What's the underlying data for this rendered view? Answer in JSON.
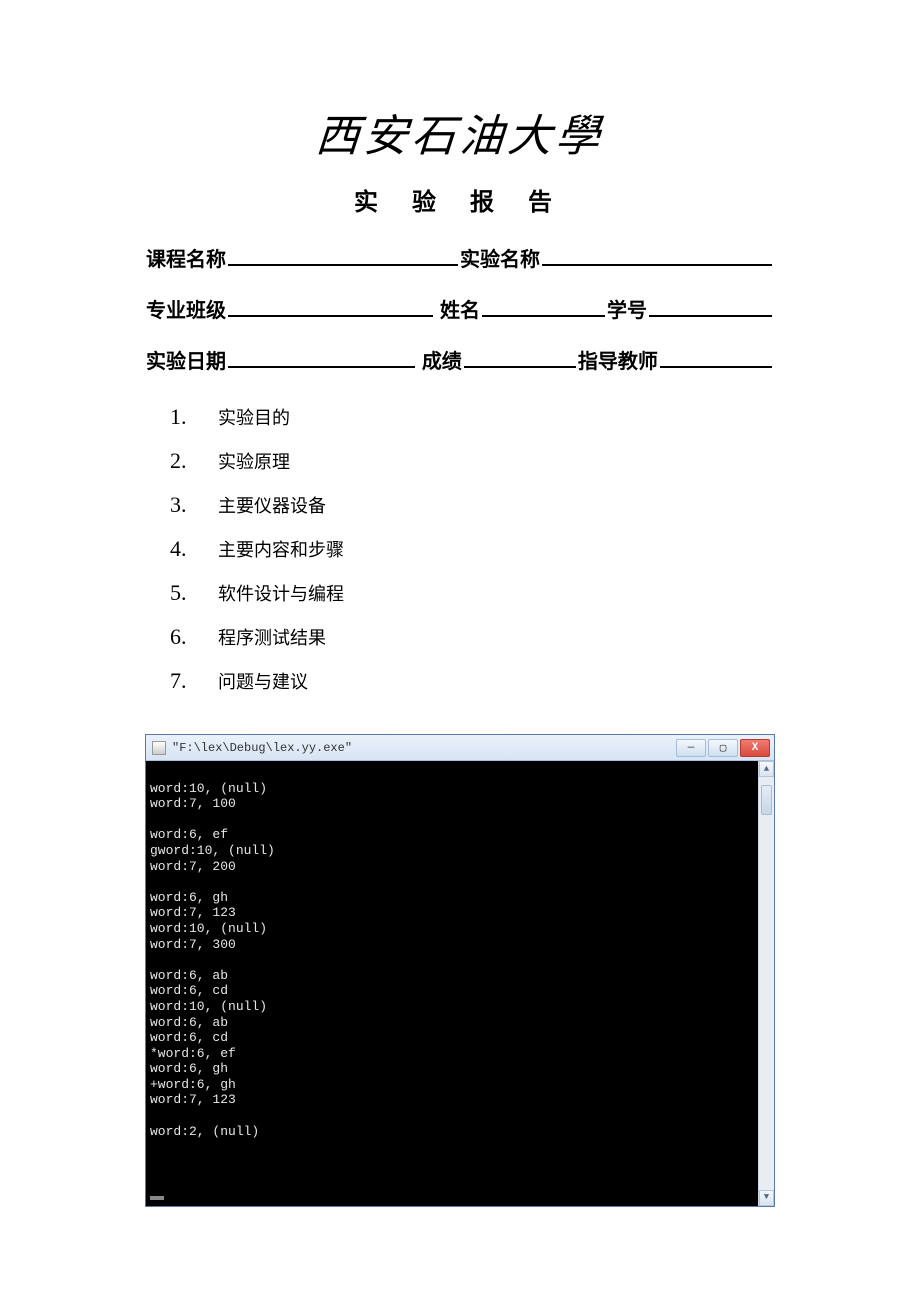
{
  "header": {
    "university": "西安石油大學",
    "title": "实 验 报 告"
  },
  "fields": {
    "course_name": "课程名称",
    "exp_name": "实验名称",
    "class": "专业班级",
    "name": "姓名",
    "sid": "学号",
    "date": "实验日期",
    "score": "成绩",
    "teacher": "指导教师"
  },
  "sections": [
    {
      "num": "1.",
      "text": "实验目的"
    },
    {
      "num": "2.",
      "text": "实验原理"
    },
    {
      "num": "3.",
      "text": "主要仪器设备"
    },
    {
      "num": "4.",
      "text": "主要内容和步骤"
    },
    {
      "num": "5.",
      "text": "软件设计与编程"
    },
    {
      "num": "6.",
      "text": "程序测试结果"
    },
    {
      "num": "7.",
      "text": "问题与建议"
    }
  ],
  "terminal": {
    "title": "\"F:\\lex\\Debug\\lex.yy.exe\"",
    "lines": [
      "word:10, (null)",
      "word:7, 100",
      "",
      "word:6, ef",
      "gword:10, (null)",
      "word:7, 200",
      "",
      "word:6, gh",
      "word:7, 123",
      "word:10, (null)",
      "word:7, 300",
      "",
      "word:6, ab",
      "word:6, cd",
      "word:10, (null)",
      "word:6, ab",
      "word:6, cd",
      "*word:6, ef",
      "word:6, gh",
      "+word:6, gh",
      "word:7, 123",
      "",
      "word:2, (null)",
      ""
    ],
    "buttons": {
      "min": "—",
      "max": "▢",
      "close": "X"
    },
    "scroll": {
      "up": "▲",
      "down": "▼"
    }
  }
}
